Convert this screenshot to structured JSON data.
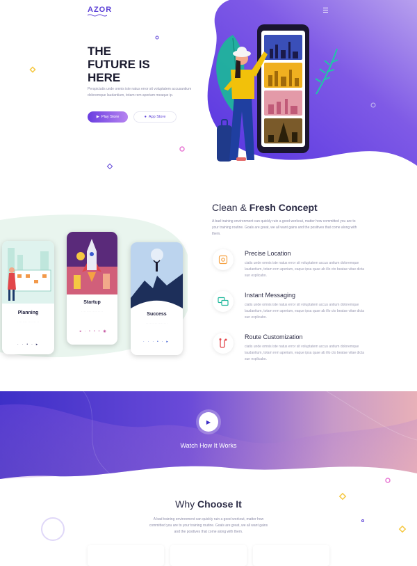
{
  "header": {
    "logo": "AZOR"
  },
  "hero": {
    "title_lines": [
      "THE",
      "FUTURE IS",
      "HERE"
    ],
    "text": "Perspiciatis unde omnis iste natus error sit voluptatem accusantium doloremque laudantium, totam rem aperiam meaque ip.",
    "play_store_label": "Play Store",
    "app_store_label": "App Store"
  },
  "concept": {
    "title_light": "Clean &",
    "title_bold": "Fresh Concept",
    "text": "A bad training environment can quickly ruin a good workout, matter how committed you are to your training routine. Goals are great, we all want gains and the positives that come along with them.",
    "features": [
      {
        "icon": "location-icon",
        "title": "Precise Location",
        "text": "ciatis unde omnis iste natus error sit voluptatem accus antium doloremque laudantium, totam rem aperiam, eaque ipsa quae ab illo cto beatae vitae dicta sun explicabo."
      },
      {
        "icon": "chat-icon",
        "title": "Instant Messaging",
        "text": "ciatis unde omnis iste natus error sit voluptatem accus antium doloremque laudantium, totam rem aperiam, eaque ipsa quae ab illo cto beatae vitae dicta sun explicabo."
      },
      {
        "icon": "route-icon",
        "title": "Route Customization",
        "text": "ciatis unde omnis iste natus error sit voluptatem accus antium doloremque laudantium, totam rem aperiam, eaque ipsa quae ab illo cto beatae vitae dicta sun explicabo."
      }
    ],
    "phones": [
      {
        "label": "Planning"
      },
      {
        "label": "Startup"
      },
      {
        "label": "Success"
      }
    ]
  },
  "video": {
    "label": "Watch How It Works"
  },
  "why": {
    "title_light": "Why",
    "title_bold": "Choose It",
    "text": "A bad training environment can quickly ruin a good workout, matter how committed you are to your training routine. Goals are great, we all want gains and the positives that come along with them."
  },
  "colors": {
    "accent": "#5b3fd6",
    "accent_light": "#b684f0",
    "orange": "#f26b3a"
  }
}
